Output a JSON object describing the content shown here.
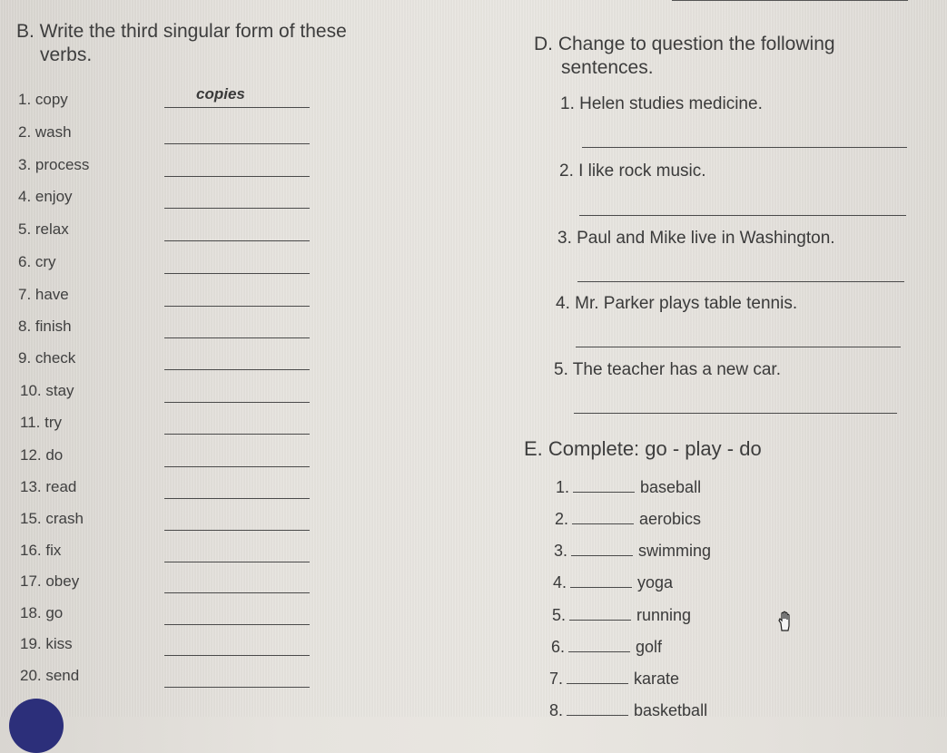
{
  "section_b": {
    "title_line1": "B. Write the third singular form of these",
    "title_line2": "verbs.",
    "items": [
      {
        "label": "1. copy",
        "answer": "copies"
      },
      {
        "label": "2. wash",
        "answer": ""
      },
      {
        "label": "3. process",
        "answer": ""
      },
      {
        "label": "4. enjoy",
        "answer": ""
      },
      {
        "label": "5. relax",
        "answer": ""
      },
      {
        "label": "6. cry",
        "answer": ""
      },
      {
        "label": "7. have",
        "answer": ""
      },
      {
        "label": "8. finish",
        "answer": ""
      },
      {
        "label": "9. check",
        "answer": ""
      },
      {
        "label": "10. stay",
        "answer": ""
      },
      {
        "label": "11. try",
        "answer": ""
      },
      {
        "label": "12. do",
        "answer": ""
      },
      {
        "label": "13. read",
        "answer": ""
      },
      {
        "label": "15. crash",
        "answer": ""
      },
      {
        "label": "16. fix",
        "answer": ""
      },
      {
        "label": "17. obey",
        "answer": ""
      },
      {
        "label": "18. go",
        "answer": ""
      },
      {
        "label": "19. kiss",
        "answer": ""
      },
      {
        "label": "20. send",
        "answer": ""
      }
    ]
  },
  "section_d": {
    "title_line1": "D. Change to question the following",
    "title_line2": "sentences.",
    "sentences": [
      "1. Helen studies medicine.",
      "2. I like rock music.",
      "3. Paul and Mike live in Washington.",
      "4. Mr. Parker plays table tennis.",
      "5. The teacher has a new car."
    ]
  },
  "section_e": {
    "title": "E. Complete: go - play - do",
    "items": [
      {
        "num": "1.",
        "word": "baseball"
      },
      {
        "num": "2.",
        "word": "aerobics"
      },
      {
        "num": "3.",
        "word": "swimming"
      },
      {
        "num": "4.",
        "word": "yoga"
      },
      {
        "num": "5.",
        "word": "running"
      },
      {
        "num": "6.",
        "word": "golf"
      },
      {
        "num": "7.",
        "word": "karate"
      },
      {
        "num": "8.",
        "word": "basketball"
      }
    ]
  },
  "icons": {
    "cursor": "hand-cursor-icon"
  }
}
